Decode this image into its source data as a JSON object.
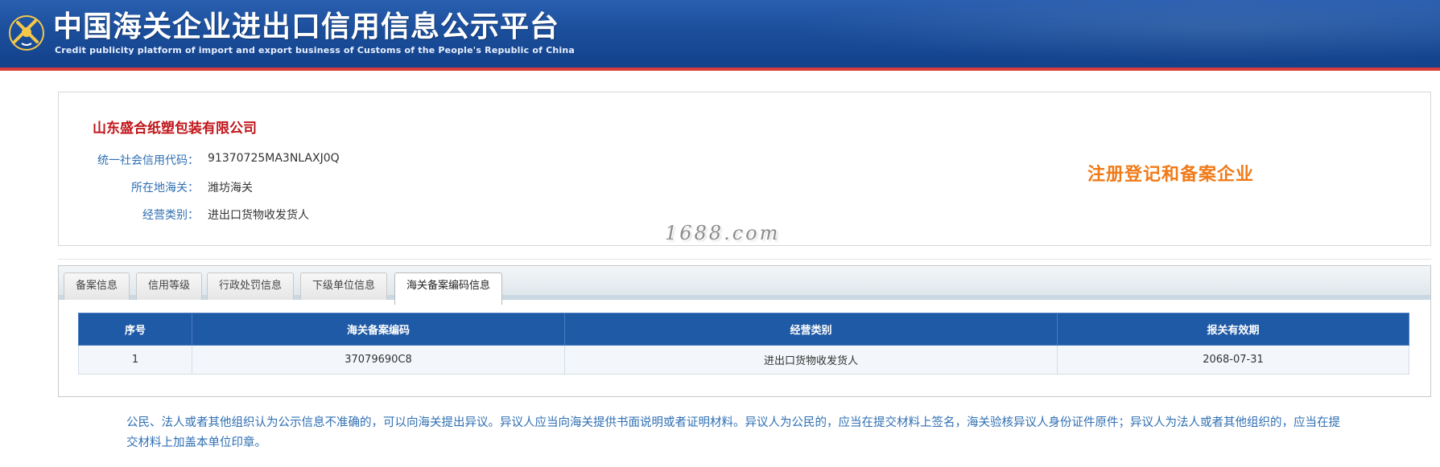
{
  "header": {
    "title_cn": "中国海关企业进出口信用信息公示平台",
    "title_en": "Credit publicity platform of import and export business of Customs of the People's Republic of China",
    "emblem_icon": "customs-emblem-icon"
  },
  "company": {
    "name": "山东盛合纸塑包装有限公司",
    "credit_code_label": "统一社会信用代码：",
    "credit_code": "91370725MA3NLAXJ0Q",
    "customs_label": "所在地海关：",
    "customs": "潍坊海关",
    "business_type_label": "经营类别：",
    "business_type": "进出口货物收发货人",
    "status": "注册登记和备案企业"
  },
  "watermark": "1688.com",
  "tabs": [
    {
      "label": "备案信息"
    },
    {
      "label": "信用等级"
    },
    {
      "label": "行政处罚信息"
    },
    {
      "label": "下级单位信息"
    },
    {
      "label": "海关备案编码信息",
      "active": true
    }
  ],
  "table": {
    "headers": [
      "序号",
      "海关备案编码",
      "经营类别",
      "报关有效期"
    ],
    "rows": [
      [
        "1",
        "37079690C8",
        "进出口货物收发货人",
        "2068-07-31"
      ]
    ]
  },
  "notice": "公民、法人或者其他组织认为公示信息不准确的，可以向海关提出异议。异议人应当向海关提供书面说明或者证明材料。异议人为公民的，应当在提交材料上签名，海关验核异议人身份证件原件；异议人为法人或者其他组织的，应当在提交材料上加盖本单位印章。",
  "colors": {
    "header_blue": "#1b4f9c",
    "accent_red": "#c0161b",
    "label_blue": "#2f6fb3",
    "status_orange": "#f07a18",
    "table_header": "#1f5aa6"
  }
}
